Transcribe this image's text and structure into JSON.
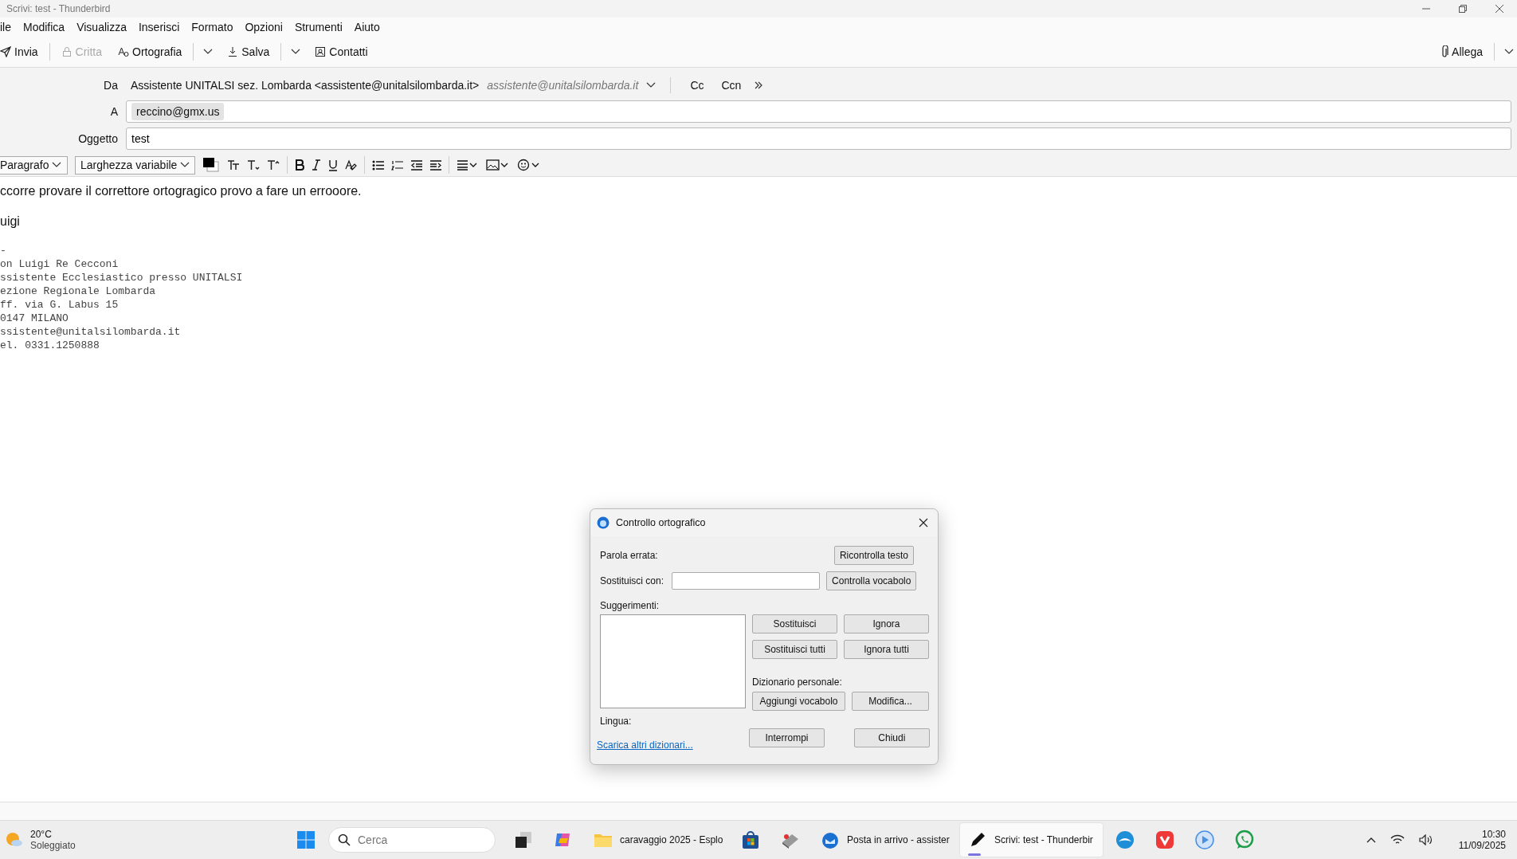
{
  "window": {
    "title": "Scrivi: test - Thunderbird"
  },
  "menu": [
    "ile",
    "Modifica",
    "Visualizza",
    "Inserisci",
    "Formato",
    "Opzioni",
    "Strumenti",
    "Aiuto"
  ],
  "toolbar": [
    {
      "kind": "send",
      "label": "Invia",
      "disabled": false,
      "dropdown": false
    },
    {
      "kind": "lock",
      "label": "Critta",
      "disabled": true,
      "dropdown": false
    },
    {
      "kind": "spell",
      "label": "Ortografia",
      "disabled": false,
      "dropdown": true
    },
    {
      "kind": "save",
      "label": "Salva",
      "disabled": false,
      "dropdown": true
    },
    {
      "kind": "contacts",
      "label": "Contatti",
      "disabled": false,
      "dropdown": false
    }
  ],
  "attach": {
    "label": "Allega"
  },
  "header": {
    "from_label": "Da",
    "from": "Assistente UNITALSI sez. Lombarda <assistente@unitalsilombarda.it>",
    "from_identity": "assistente@unitalsilombarda.it",
    "cc": "Cc",
    "bcc": "Ccn",
    "to_label": "A",
    "recipients": [
      "reccino@gmx.us"
    ],
    "subject_label": "Oggetto",
    "subject": "test"
  },
  "format_bar": {
    "paragraph": "Paragrafo",
    "font": "Larghezza variabile"
  },
  "body": {
    "paragraphs": [
      "ccorre provare il correttore ortogragico provo a fare un errooore.",
      "uigi"
    ],
    "signature": [
      "-",
      "on Luigi Re Cecconi",
      "ssistente Ecclesiastico presso UNITALSI",
      "ezione Regionale Lombarda",
      "ff. via G. Labus 15",
      "0147 MILANO",
      "ssistente@unitalsilombarda.it",
      "el. 0331.1250888"
    ]
  },
  "dialog": {
    "title": "Controllo ortografico",
    "misspelled_label": "Parola errata:",
    "replace_label": "Sostituisci con:",
    "suggestions_label": "Suggerimenti:",
    "dictionary_label": "Dizionario personale:",
    "language_label": "Lingua:",
    "link": "Scarica altri dizionari...",
    "buttons": {
      "recheck": "Ricontrolla testo",
      "check": "Controlla vocabolo",
      "replace": "Sostituisci",
      "ignore": "Ignora",
      "replace_all": "Sostituisci tutti",
      "ignore_all": "Ignora tutti",
      "add": "Aggiungi vocabolo",
      "edit": "Modifica...",
      "stop": "Interrompi",
      "close": "Chiudi"
    }
  },
  "taskbar": {
    "weather": {
      "temp": "20°C",
      "condition": "Soleggiato"
    },
    "search_placeholder": "Cerca",
    "apps": [
      {
        "kind": "taskview",
        "selected": false
      },
      {
        "kind": "copilot",
        "selected": false
      },
      {
        "kind": "folder",
        "label": "caravaggio 2025 - Esplo",
        "selected": false
      },
      {
        "kind": "store",
        "selected": false
      },
      {
        "kind": "scanner",
        "selected": false
      },
      {
        "kind": "mail",
        "label": "Posta in arrivo - assister",
        "selected": false
      },
      {
        "kind": "pen",
        "label": "Scrivi: test - Thunderbir",
        "selected": true
      },
      {
        "kind": "bird",
        "selected": false
      },
      {
        "kind": "vivaldi",
        "selected": false
      },
      {
        "kind": "play",
        "selected": false
      },
      {
        "kind": "whatsapp",
        "selected": false
      }
    ],
    "time": "10:30",
    "date": "11/09/2025"
  }
}
